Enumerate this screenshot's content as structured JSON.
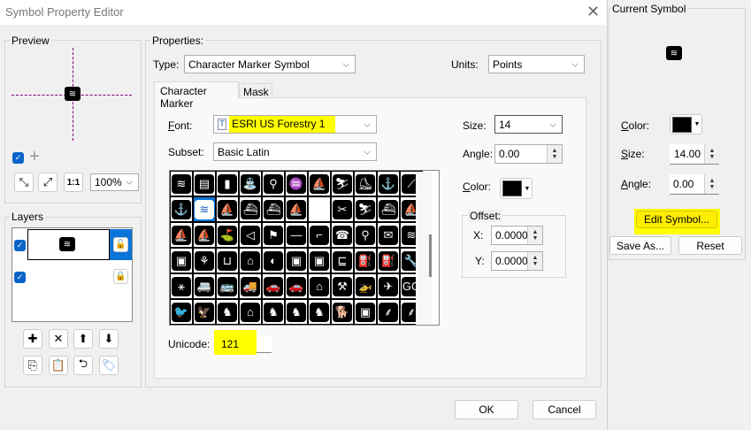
{
  "window": {
    "title": "Symbol Property Editor",
    "close_icon": "close-icon"
  },
  "preview": {
    "label": "Preview",
    "zoom": "100%",
    "symbol_glyph": "≋",
    "checked": true
  },
  "layers": {
    "label": "Layers",
    "items": [
      {
        "checked": true,
        "selected": true,
        "symbol_glyph": "≋",
        "lock": "unlocked"
      },
      {
        "checked": true,
        "selected": false,
        "lock": "locked"
      }
    ]
  },
  "properties": {
    "label": "Properties:",
    "type_label": "Type:",
    "type_value": "Character Marker Symbol",
    "units_label": "Units:",
    "units_value": "Points",
    "tabs": [
      {
        "label": "Character Marker",
        "active": true
      },
      {
        "label": "Mask",
        "active": false
      }
    ],
    "font_label": "Font:",
    "font_value": "ESRI US Forestry 1",
    "subset_label": "Subset:",
    "subset_value": "Basic Latin",
    "unicode_label": "Unicode:",
    "unicode_value": "121",
    "size_label": "Size:",
    "size_value": "14",
    "angle_label": "Angle:",
    "angle_value": "0.00",
    "color_label": "Color:",
    "color_value": "#000000",
    "offset_label": "Offset:",
    "x_label": "X:",
    "x_value": "0.0000",
    "y_label": "Y:",
    "y_value": "0.0000"
  },
  "glyphs": [
    "≋",
    "▤",
    "▮",
    "⛲",
    "⚲",
    "♒",
    "⛵",
    "⛷",
    "⛸",
    "⚓",
    "⟋",
    "⚓",
    "≋",
    "⛵",
    "⛴",
    "⛴",
    "⛵",
    "",
    "✂",
    "⛷",
    "⛴",
    "⛵",
    "⛵",
    "⛵",
    "⛳",
    "◁",
    "⚑",
    "—",
    "⌐",
    "☎",
    "⚲",
    "✉",
    "≋",
    "▣",
    "⚘",
    "⊔",
    "⌂",
    "◐",
    "▣",
    "▣",
    "⊑",
    "⛽",
    "⛽",
    "🔧",
    "⚹",
    "🚐",
    "🚌",
    "🚚",
    "🚗",
    "🚗",
    "⌂",
    "⚒",
    "🚁",
    "✈",
    "GG",
    "🐦",
    "🦅",
    "♞",
    "⌂",
    "♞",
    "♞",
    "♞",
    "🐕",
    "▣",
    "⸙",
    "⸙"
  ],
  "selected_glyph_index": 12,
  "highlight_color": "#ffff00",
  "footer": {
    "ok": "OK",
    "cancel": "Cancel"
  },
  "current_symbol": {
    "label": "Current Symbol",
    "symbol_glyph": "≋",
    "color_label": "Color:",
    "color_value": "#000000",
    "size_label": "Size:",
    "size_value": "14.00",
    "angle_label": "Angle:",
    "angle_value": "0.00",
    "edit_button": "Edit Symbol...",
    "save_as_button": "Save As...",
    "reset_button": "Reset"
  }
}
